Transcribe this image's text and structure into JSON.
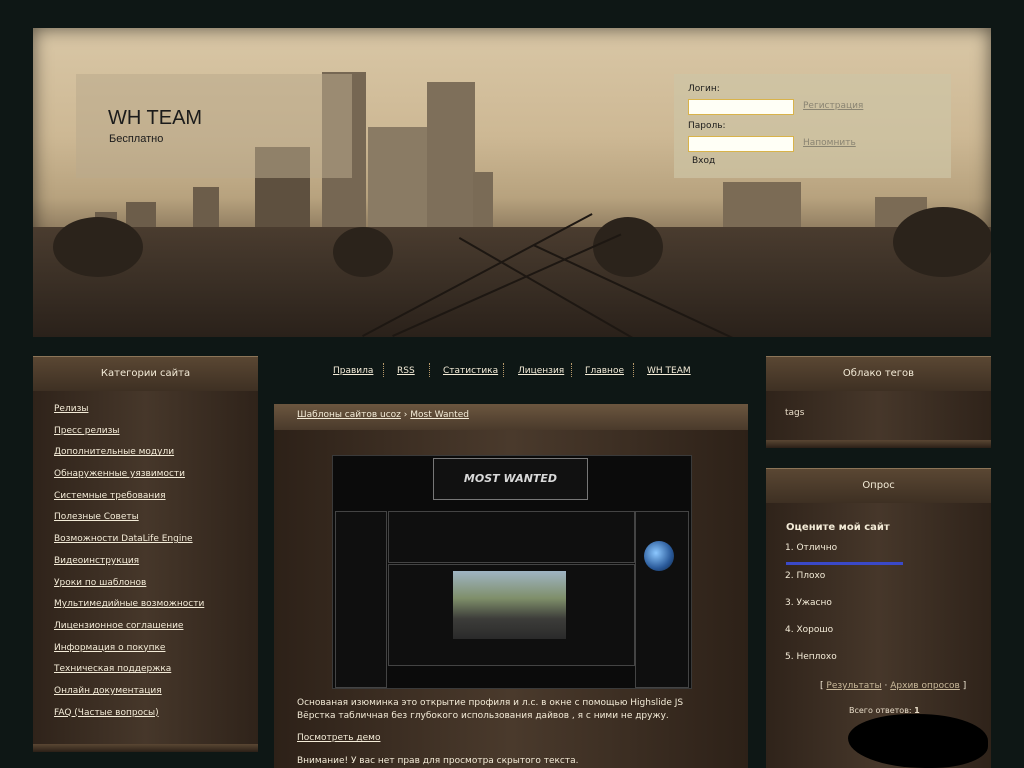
{
  "header": {
    "site_title": "WH TEAM",
    "site_subtitle": "Бесплатно"
  },
  "login": {
    "login_label": "Логин:",
    "password_label": "Пароль:",
    "register_link": "Регистрация",
    "remind_link": "Напомнить",
    "submit_label": "Вход"
  },
  "categories": {
    "title": "Категории сайта",
    "items": [
      "Релизы",
      "Пресс релизы",
      "Дополнительные модули",
      "Обнаруженные уязвимости",
      "Системные требования",
      "Полезные Советы",
      "Возможности DataLife Engine",
      "Видеоинструкция",
      "Уроки по шаблонов",
      "Мультимедийные возможности",
      "Лицензионное соглашение",
      "Информация о покупке",
      "Техническая поддержка",
      "Онлайн документация",
      "FAQ (Частые вопросы)"
    ]
  },
  "nav": {
    "items": [
      "Правила",
      "RSS",
      "Статистика",
      "Лицензия",
      "Главное",
      "WH TEAM"
    ]
  },
  "main": {
    "breadcrumb_root": "Шаблоны сайтов ucoz",
    "breadcrumb_sep": "›",
    "breadcrumb_current": "Most Wanted",
    "preview_logo_text": "MOST WANTED",
    "description_line1": "Основаная изюминка это открытие профиля и л.с. в окне с помощью Highslide JS",
    "description_line2": "Вёрстка табличная без глубокого использования дайвов , я с ними не дружу.",
    "demo_link": "Посмотреть демо",
    "notice": "Внимание! У вас нет прав для просмотра скрытого текста."
  },
  "tags": {
    "title": "Облако тегов",
    "content": "tags"
  },
  "poll": {
    "title": "Опрос",
    "question": "Оцените мой сайт",
    "options": [
      "1. Отлично",
      "2. Плохо",
      "3. Ужасно",
      "4. Хорошо",
      "5. Неплохо"
    ],
    "option1_share": 1.0,
    "bar_color": "#3a49c8",
    "results_link": "Результаты",
    "archive_link": "Архив опросов",
    "total_label": "Всего ответов:",
    "total_value": "1"
  }
}
